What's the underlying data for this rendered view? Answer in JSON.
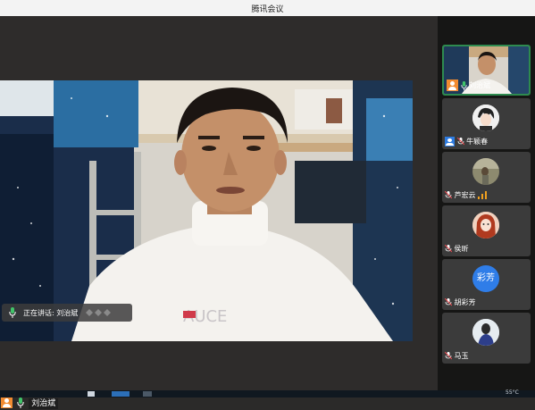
{
  "window": {
    "title": "腾讯会议"
  },
  "main_video": {
    "speaking_label": "正在讲话: 刘治斌",
    "name": "刘治斌",
    "speaker_person_description": "young man with short black hair in a white knit sweater, seated before a dorm bunk with blue starry curtains"
  },
  "participants": [
    {
      "name": "刘治斌",
      "active": true,
      "host": true
    },
    {
      "name": "牛颖春",
      "cohost": true
    },
    {
      "name": "芦宏云",
      "signal": true
    },
    {
      "name": "侯昕"
    },
    {
      "name": "胡彩芳",
      "avatar_text": "彩芳"
    },
    {
      "name": "马玉"
    }
  ],
  "taskbar": {
    "clock": "55°C"
  },
  "colors": {
    "accent_green": "#2e8b4f",
    "host_orange": "#f28b30",
    "cohost_blue": "#2d7be0",
    "avatar_blue": "#2f7de8"
  }
}
